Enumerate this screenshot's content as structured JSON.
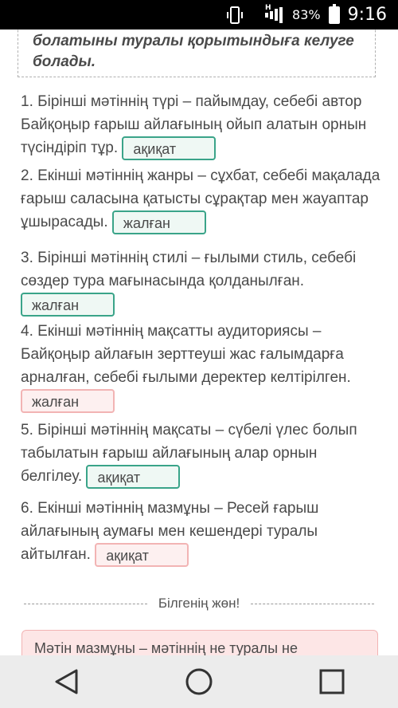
{
  "status_bar": {
    "network_label": "H",
    "battery": "83%",
    "time": "9:16"
  },
  "conclusion": {
    "text": "болатыны туралы қорытындыға келуге болады."
  },
  "statements": [
    {
      "text": "1. Бірінші мәтіннің түрі – пайымдау, себебі автор Байқоңыр ғарыш айлағының ойып алатын орнын түсіндіріп тұр.",
      "answer": "ақиқат",
      "state": "correct"
    },
    {
      "text": "2. Екінші мәтіннің жанры – сұхбат, себебі мақалада ғарыш саласына қатысты сұрақтар мен жауаптар ұшырасады.",
      "answer": "жалған",
      "state": "correct"
    },
    {
      "text": "3. Бірінші мәтіннің стилі – ғылыми стиль, себебі сөздер тура мағынасында қолданылған.",
      "answer": "жалған",
      "state": "correct"
    },
    {
      "text": "4. Екінші мәтіннің мақсатты аудиториясы – Байқоңыр айлағын зерттеуші жас ғалымдарға арналған, себебі ғылыми деректер келтірілген.",
      "answer": "жалған",
      "state": "wrong"
    },
    {
      "text": "5. Бірінші мәтіннің мақсаты – сүбелі үлес болып табылатын ғарыш айлағының алар орнын белгілеу.",
      "answer": "ақиқат",
      "state": "correct"
    },
    {
      "text": "6. Екінші мәтіннің мазмұны – Ресей ғарыш айлағының аумағы мен кешендері туралы айтылған.",
      "answer": "ақиқат",
      "state": "wrong"
    }
  ],
  "section": {
    "divider_label": "Білгенің жөн!",
    "info_text": "Мәтін мазмұны – мәтіннің не туралы не"
  },
  "nav": {
    "back_icon": "triangle-back-icon",
    "home_icon": "circle-home-icon",
    "recents_icon": "square-recents-icon"
  },
  "colors": {
    "correct_border": "#3aa489",
    "wrong_border": "#f2b4b4",
    "info_bg": "#fde6e6"
  }
}
